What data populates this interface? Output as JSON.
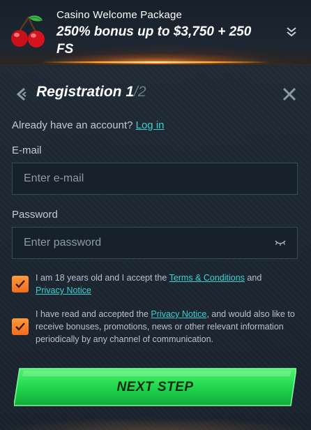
{
  "promo": {
    "subtitle": "Casino Welcome Package",
    "title": "250% bonus up to $3,750 + 250 FS",
    "icon": "cherries-icon",
    "toggle_icon": "chevron-down-icon"
  },
  "header": {
    "title": "Registration",
    "step_current": "1",
    "step_total": "/2",
    "back_icon": "chevron-left-icon",
    "close_icon": "close-icon"
  },
  "login": {
    "prompt": "Already have an account?",
    "link": "Log in"
  },
  "email": {
    "label": "E-mail",
    "placeholder": "Enter e-mail",
    "value": ""
  },
  "password": {
    "label": "Password",
    "placeholder": "Enter password",
    "value": "",
    "toggle_icon": "eye-closed-icon"
  },
  "consent_age": {
    "checked": true,
    "text_before": "I am 18 years old and I accept the",
    "terms_link": "Terms & Conditions",
    "text_and": "and",
    "privacy_link": "Privacy Notice"
  },
  "consent_marketing": {
    "checked": true,
    "text_before": "I have read and accepted the",
    "privacy_link": "Privacy Notice",
    "text_after": ", and would also like to receive bonuses, promotions, news or other relevant information periodically by any channel of communication."
  },
  "actions": {
    "next_label": "NEXT STEP"
  },
  "colors": {
    "accent_link": "#39d2d0",
    "checkbox": "#f26b1d",
    "button_green": "#22d64e",
    "background": "#1c2530"
  }
}
